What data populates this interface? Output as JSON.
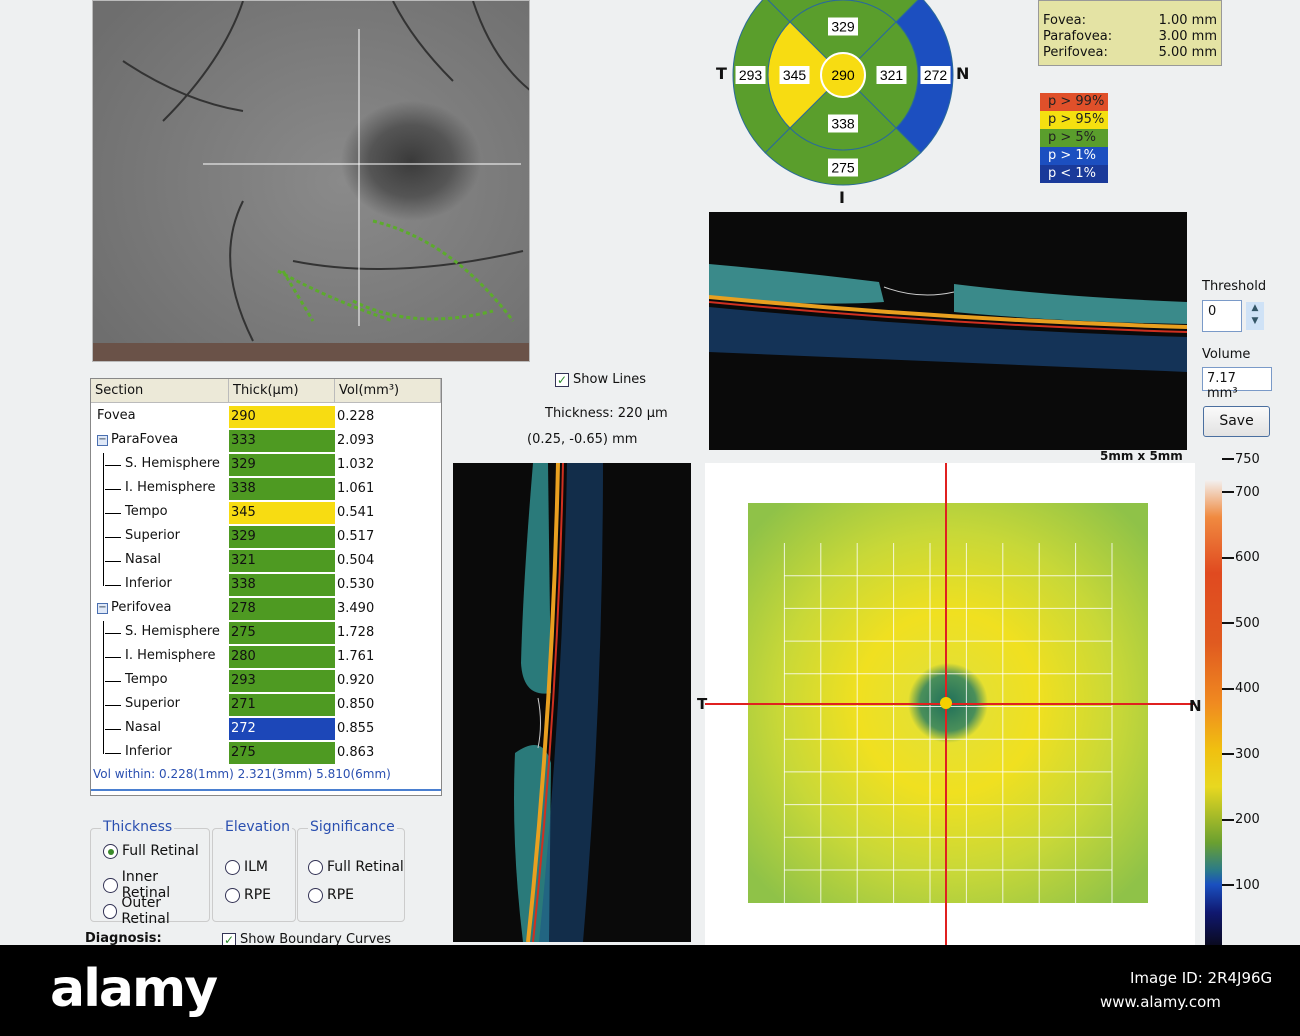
{
  "fundus": {
    "name": "fundus-image"
  },
  "table": {
    "headers": [
      "Section",
      "Thick(µm)",
      "Vol(mm³)"
    ],
    "rows": [
      {
        "name": "Fovea",
        "thick": "290",
        "vol": "0.228",
        "color": "#f7dc12",
        "level": 0
      },
      {
        "name": "ParaFovea",
        "thick": "333",
        "vol": "2.093",
        "color": "#4e9a22",
        "level": 0,
        "expander": "-"
      },
      {
        "name": "S. Hemisphere",
        "thick": "329",
        "vol": "1.032",
        "color": "#4e9a22",
        "level": 1
      },
      {
        "name": "I. Hemisphere",
        "thick": "338",
        "vol": "1.061",
        "color": "#4e9a22",
        "level": 1
      },
      {
        "name": "Tempo",
        "thick": "345",
        "vol": "0.541",
        "color": "#f7dc12",
        "level": 1
      },
      {
        "name": "Superior",
        "thick": "329",
        "vol": "0.517",
        "color": "#4e9a22",
        "level": 1
      },
      {
        "name": "Nasal",
        "thick": "321",
        "vol": "0.504",
        "color": "#4e9a22",
        "level": 1
      },
      {
        "name": "Inferior",
        "thick": "338",
        "vol": "0.530",
        "color": "#4e9a22",
        "level": 1,
        "last": true
      },
      {
        "name": "Perifovea",
        "thick": "278",
        "vol": "3.490",
        "color": "#4e9a22",
        "level": 0,
        "expander": "-"
      },
      {
        "name": "S. Hemisphere",
        "thick": "275",
        "vol": "1.728",
        "color": "#4e9a22",
        "level": 1
      },
      {
        "name": "I. Hemisphere",
        "thick": "280",
        "vol": "1.761",
        "color": "#4e9a22",
        "level": 1
      },
      {
        "name": "Tempo",
        "thick": "293",
        "vol": "0.920",
        "color": "#4e9a22",
        "level": 1
      },
      {
        "name": "Superior",
        "thick": "271",
        "vol": "0.850",
        "color": "#4e9a22",
        "level": 1
      },
      {
        "name": "Nasal",
        "thick": "272",
        "vol": "0.855",
        "color": "#1c47b8",
        "level": 1
      },
      {
        "name": "Inferior",
        "thick": "275",
        "vol": "0.863",
        "color": "#4e9a22",
        "level": 1,
        "last": true
      }
    ],
    "vol_within": "Vol within: 0.228(1mm) 2.321(3mm) 5.810(6mm)"
  },
  "options": {
    "thickness": {
      "title": "Thickness",
      "items": [
        "Full Retinal",
        "Inner Retinal",
        "Outer Retinal"
      ],
      "selected": 0
    },
    "elevation": {
      "title": "Elevation",
      "items": [
        "ILM",
        "RPE"
      ]
    },
    "significance": {
      "title": "Significance",
      "items": [
        "Full Retinal",
        "RPE"
      ]
    },
    "diagnosis_label": "Diagnosis:",
    "show_boundary_curves": "Show Boundary Curves"
  },
  "bscan": {
    "show_lines": "Show Lines",
    "thickness": "Thickness: 220 µm",
    "coords": "(0.25, -0.65) mm"
  },
  "etdrs": {
    "labels": {
      "t": "T",
      "n": "N",
      "i": "I"
    },
    "center": {
      "value": "290",
      "color": "#f7dc12"
    },
    "inner": {
      "superior": {
        "value": "329",
        "color": "#5a9e2c"
      },
      "nasal": {
        "value": "321",
        "color": "#5a9e2c"
      },
      "inferior": {
        "value": "338",
        "color": "#5a9e2c"
      },
      "temporal": {
        "value": "345",
        "color": "#f7dc12"
      }
    },
    "outer": {
      "superior": {
        "color": "#5a9e2c"
      },
      "nasal": {
        "value": "272",
        "color": "#1c4fc0"
      },
      "inferior": {
        "value": "275",
        "color": "#5a9e2c"
      },
      "temporal": {
        "value": "293",
        "color": "#5a9e2c"
      }
    }
  },
  "diameters": [
    {
      "label": "Fovea:",
      "value": "1.00 mm"
    },
    {
      "label": "Parafovea:",
      "value": "3.00 mm"
    },
    {
      "label": "Perifovea:",
      "value": "5.00 mm"
    }
  ],
  "significance_legend": [
    {
      "label": "p > 99%",
      "color": "#e0502a"
    },
    {
      "label": "p > 95%",
      "color": "#f5e010"
    },
    {
      "label": "p > 5%",
      "color": "#5a9e2c"
    },
    {
      "label": "p > 1%",
      "color": "#1c4fc0",
      "text": "#fff"
    },
    {
      "label": "p < 1%",
      "color": "#1a3a9a",
      "text": "#fff"
    }
  ],
  "controls": {
    "threshold_label": "Threshold",
    "threshold_value": "0",
    "volume_label": "Volume",
    "volume_value": "7.17 mm³",
    "save": "Save"
  },
  "map": {
    "size_label": "5mm x 5mm",
    "t": "T",
    "n": "N"
  },
  "colorbar": {
    "ticks": [
      "750",
      "700",
      "600",
      "500",
      "400",
      "300",
      "200",
      "100"
    ]
  },
  "watermark": {
    "brand": "alamy",
    "image_id": "Image ID: 2R4J96G",
    "url": "www.alamy.com"
  }
}
